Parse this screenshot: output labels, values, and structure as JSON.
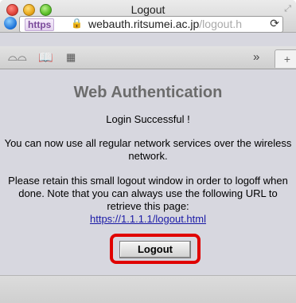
{
  "window": {
    "title": "Logout"
  },
  "urlbar": {
    "https_label": "https",
    "url_main": "webauth.ritsumei.ac.jp",
    "url_tail": "/logout.h"
  },
  "page": {
    "heading": "Web Authentication",
    "login_message": "Login Successful !",
    "network_message": "You can now use all regular network services over the wireless network.",
    "retain_message": "Please retain this small logout window in order to logoff when done. Note that you can always use the following URL to retrieve this page:",
    "logout_url": "https://1.1.1.1/logout.html",
    "logout_button": "Logout"
  },
  "icons": {
    "close": "close-icon",
    "minimize": "minimize-icon",
    "maximize": "maximize-icon",
    "resize": "resize-icon",
    "globe": "globe-icon",
    "lock": "lock-icon",
    "reload": "reload-icon",
    "reader": "reader-glasses-icon",
    "bookmarks": "bookmarks-book-icon",
    "top_sites": "grid-icon",
    "more": "chevron-right-icon",
    "new_tab": "plus-icon"
  },
  "colors": {
    "highlight_border": "#e00000",
    "link": "#1a1aa6",
    "heading": "#6c6c6c"
  }
}
